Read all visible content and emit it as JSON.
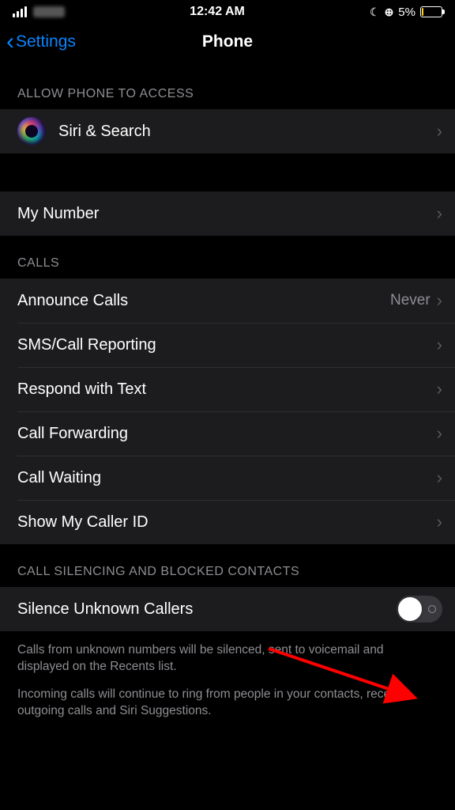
{
  "status": {
    "time": "12:42 AM",
    "battery_pct": "5%"
  },
  "nav": {
    "back_label": "Settings",
    "title": "Phone"
  },
  "sections": {
    "access_header": "ALLOW PHONE TO ACCESS",
    "siri_label": "Siri & Search",
    "my_number_label": "My Number",
    "calls_header": "CALLS",
    "announce_label": "Announce Calls",
    "announce_value": "Never",
    "sms_label": "SMS/Call Reporting",
    "respond_label": "Respond with Text",
    "forwarding_label": "Call Forwarding",
    "waiting_label": "Call Waiting",
    "callerid_label": "Show My Caller ID",
    "silence_header": "CALL SILENCING AND BLOCKED CONTACTS",
    "silence_label": "Silence Unknown Callers",
    "footer1": "Calls from unknown numbers will be silenced, sent to voicemail and displayed on the Recents list.",
    "footer2": "Incoming calls will continue to ring from people in your contacts, recent outgoing calls and Siri Suggestions."
  }
}
